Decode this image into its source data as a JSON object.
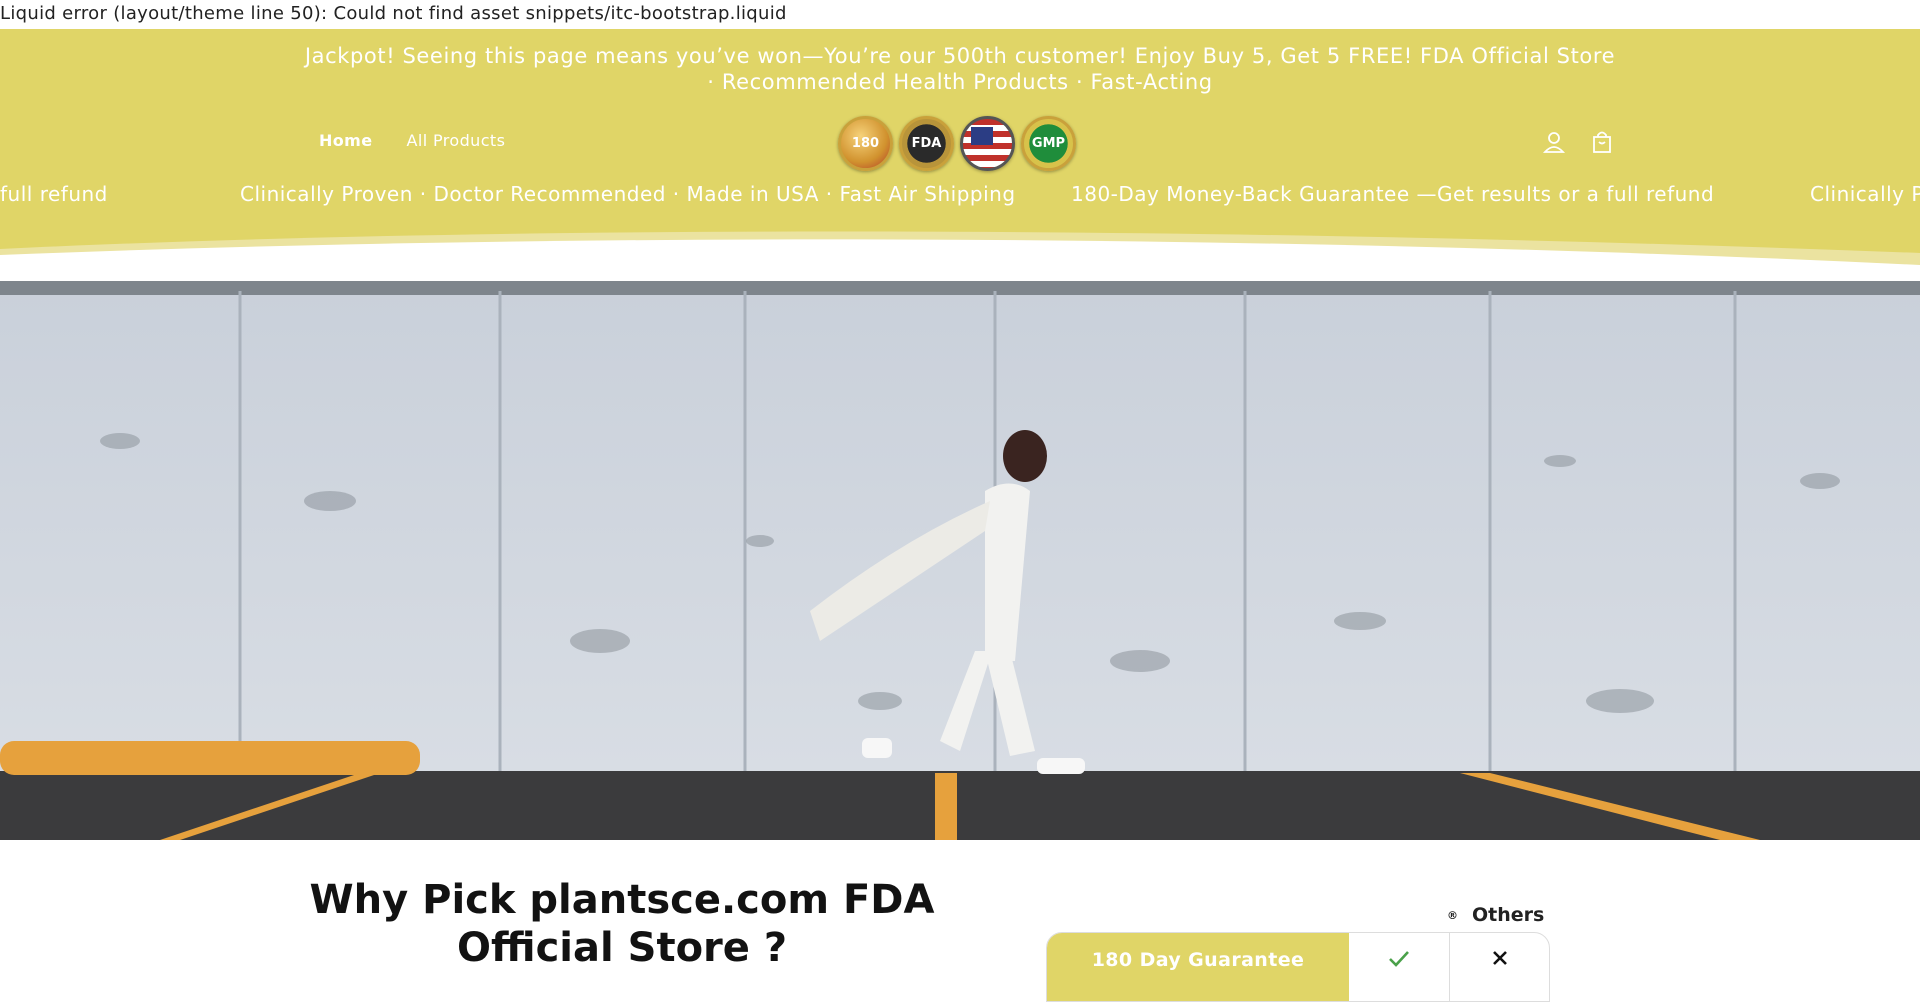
{
  "error_banner": "Liquid error (layout/theme line 50): Could not find asset snippets/itc-bootstrap.liquid",
  "header": {
    "announcement": "Jackpot! Seeing this page means you’ve won—You’re our 500th customer! Enjoy Buy 5, Get 5 FREE!  FDA Official Store · Recommended Health Products · Fast-Acting",
    "nav": [
      "Home",
      "All Products"
    ],
    "badges": [
      "180",
      "FDA",
      "USA",
      "GMP"
    ],
    "icons": [
      "account-icon",
      "cart-icon"
    ],
    "marquee": [
      "full refund",
      "Clinically Proven · Doctor Recommended · Made in USA · Fast Air Shipping",
      "180-Day Money-Back Guarantee —Get results or a full refund",
      "Clinically P"
    ]
  },
  "colors": {
    "accent": "#e0d567",
    "text": "#121212",
    "white": "#ffffff"
  },
  "why": {
    "title": "Why Pick plantsce.com FDA Official Store ?"
  },
  "compare": {
    "registered_mark": "®",
    "others": "Others",
    "row_label": "180 Day Guarantee",
    "ours": "check-icon",
    "theirs": "cross-icon"
  }
}
